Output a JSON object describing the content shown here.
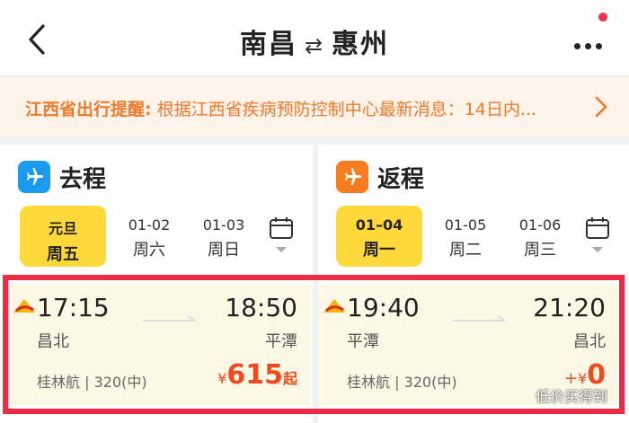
{
  "header": {
    "origin": "南昌",
    "swap_glyph": "⇄",
    "destination": "惠州"
  },
  "notice": {
    "label": "江西省出行提醒:",
    "text": "根据江西省疾病预防控制中心最新消息：14日内..."
  },
  "outbound": {
    "title": "去程",
    "dates": [
      {
        "line1": "元旦",
        "line2": "周五",
        "selected": true
      },
      {
        "line1": "01-02",
        "line2": "周六",
        "selected": false
      },
      {
        "line1": "01-03",
        "line2": "周日",
        "selected": false
      }
    ],
    "flight": {
      "dep_time": "17:15",
      "arr_time": "18:50",
      "dep_airport": "昌北",
      "arr_airport": "平潭",
      "info": "桂林航 | 320(中)",
      "currency": "¥",
      "price": "615",
      "suffix": "起"
    }
  },
  "return": {
    "title": "返程",
    "dates": [
      {
        "line1": "01–04",
        "line2": "周一",
        "selected": true
      },
      {
        "line1": "01-05",
        "line2": "周二",
        "selected": false
      },
      {
        "line1": "01-06",
        "line2": "周三",
        "selected": false
      }
    ],
    "flight": {
      "dep_time": "19:40",
      "arr_time": "21:20",
      "dep_airport": "平潭",
      "arr_airport": "昌北",
      "info": "桂林航 | 320(中)",
      "prefix": "+",
      "currency": "¥",
      "price": "0"
    }
  },
  "watermark": "低价买得到",
  "colors": {
    "accent_yellow": "#ffd83a",
    "price_red": "#f04a1e",
    "notice_orange": "#f07a2a",
    "highlight_red": "#ef2a45",
    "outbound_icon": "#1a9bf0",
    "return_icon": "#f57c1f"
  },
  "icons": [
    "back-arrow-icon",
    "more-icon",
    "chevron-right-icon",
    "plane-icon",
    "calendar-icon",
    "airline-logo-icon"
  ]
}
